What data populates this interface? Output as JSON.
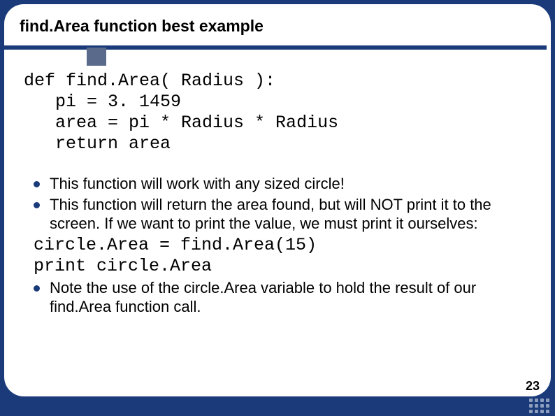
{
  "title": "find.Area function best example",
  "code": "def find.Area( Radius ):\n   pi = 3. 1459\n   area = pi * Radius * Radius\n   return area",
  "bullets": {
    "b1": "This function will work with any sized circle!",
    "b2": "This function will return the area found, but will NOT print it to the screen. If we want to print the value, we must print it ourselves:",
    "code2": "circle.Area = find.Area(15)\nprint circle.Area",
    "b3": "Note the use of the circle.Area variable to hold the result of our find.Area function call."
  },
  "page_number": "23"
}
